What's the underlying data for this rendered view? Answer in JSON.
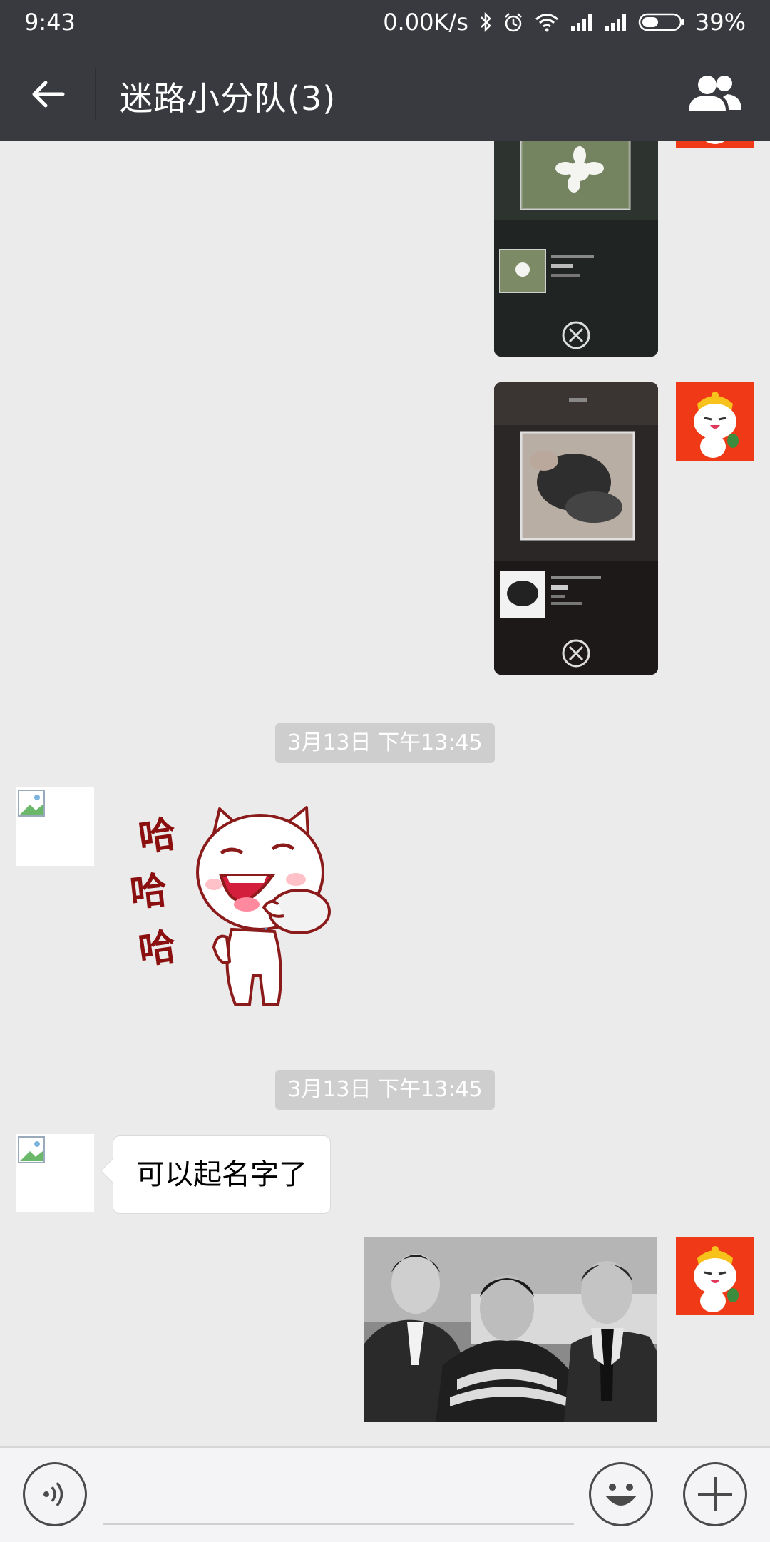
{
  "status_bar": {
    "time": "9:43",
    "net_speed": "0.00K/s",
    "battery": "39%"
  },
  "header": {
    "title": "迷路小分队(3)",
    "back_icon": "back-arrow-icon",
    "members_icon": "group-members-icon"
  },
  "chat": {
    "messages": [
      {
        "sender": "me",
        "type": "image",
        "content": "app-screenshot-flower"
      },
      {
        "sender": "me",
        "type": "image",
        "content": "app-screenshot-plant"
      },
      {
        "type": "timestamp",
        "text": "3月13日 下午13:45"
      },
      {
        "sender": "other",
        "type": "sticker",
        "sticker_text": [
          "哈",
          "哈",
          "哈"
        ]
      },
      {
        "type": "timestamp",
        "text": "3月13日 下午13:45"
      },
      {
        "sender": "other",
        "type": "text",
        "text": "可以起名字了"
      },
      {
        "sender": "me",
        "type": "image",
        "content": "photo-three-men"
      }
    ]
  },
  "input_bar": {
    "voice_icon": "voice-icon",
    "emoji_icon": "emoji-icon",
    "plus_icon": "plus-icon"
  },
  "colors": {
    "header_bg": "#393a3f",
    "chat_bg": "#ebebeb",
    "my_avatar_bg": "#f03a17"
  }
}
